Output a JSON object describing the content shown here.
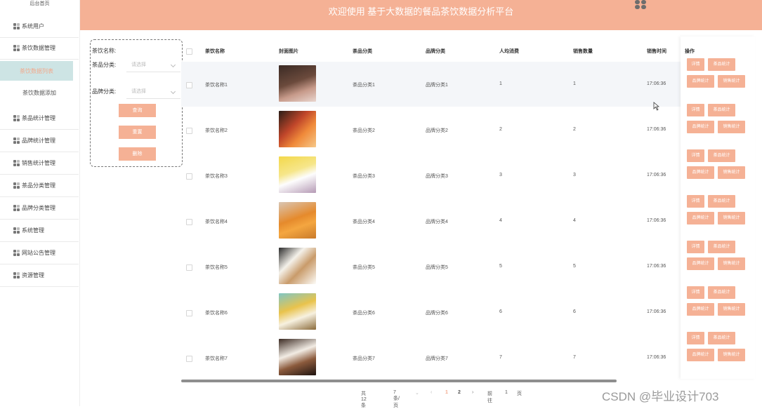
{
  "sidebar": {
    "home": "后台首页",
    "items": [
      {
        "label": "系统用户"
      },
      {
        "label": "茶饮数据管理"
      },
      {
        "label": "茶品统计管理"
      },
      {
        "label": "品牌统计管理"
      },
      {
        "label": "销售统计管理"
      },
      {
        "label": "茶品分类管理"
      },
      {
        "label": "品牌分类管理"
      },
      {
        "label": "系统管理"
      },
      {
        "label": "网站公告管理"
      },
      {
        "label": "资源管理"
      }
    ],
    "subitems": [
      {
        "label": "茶饮数据列表",
        "active": true
      },
      {
        "label": "茶饮数据添加",
        "active": false
      }
    ]
  },
  "header": {
    "title": "欢迎使用 基于大数据的餐品茶饮数据分析平台"
  },
  "search": {
    "name_label": "茶饮名称:",
    "category_label": "茶品分类:",
    "category_placeholder": "请选择",
    "brand_label": "品牌分类:",
    "brand_placeholder": "请选择",
    "query_button": "查询",
    "reset_button": "重置",
    "delete_button": "删除"
  },
  "table": {
    "columns": [
      "茶饮名称",
      "封面图片",
      "茶品分类",
      "品牌分类",
      "人均消费",
      "销售数量",
      "销售时间",
      "操作"
    ],
    "rows": [
      {
        "name": "茶饮名称1",
        "category": "茶品分类1",
        "brand": "品牌分类1",
        "avg": "1",
        "qty": "1",
        "time": "17:06:36"
      },
      {
        "name": "茶饮名称2",
        "category": "茶品分类2",
        "brand": "品牌分类2",
        "avg": "2",
        "qty": "2",
        "time": "17:06:36"
      },
      {
        "name": "茶饮名称3",
        "category": "茶品分类3",
        "brand": "品牌分类3",
        "avg": "3",
        "qty": "3",
        "time": "17:06:36"
      },
      {
        "name": "茶饮名称4",
        "category": "茶品分类4",
        "brand": "品牌分类4",
        "avg": "4",
        "qty": "4",
        "time": "17:06:36"
      },
      {
        "name": "茶饮名称5",
        "category": "茶品分类5",
        "brand": "品牌分类5",
        "avg": "5",
        "qty": "5",
        "time": "17:06:36"
      },
      {
        "name": "茶饮名称6",
        "category": "茶品分类6",
        "brand": "品牌分类6",
        "avg": "6",
        "qty": "6",
        "time": "17:06:36"
      },
      {
        "name": "茶饮名称7",
        "category": "茶品分类7",
        "brand": "品牌分类7",
        "avg": "7",
        "qty": "7",
        "time": "17:06:36"
      }
    ],
    "actions": {
      "detail": "详情",
      "tea_stats": "茶品统计",
      "brand_stats": "品牌统计",
      "sales_stats": "销售统计"
    }
  },
  "pagination": {
    "total": "共 12 条",
    "page_size": "7条/页",
    "pages": [
      "1",
      "2"
    ],
    "goto_label": "前往",
    "goto_value": "1",
    "page_unit": "页"
  },
  "watermark": "CSDN @毕业设计703",
  "colors": {
    "accent": "#f5b195",
    "active_bg": "#cde4e4"
  }
}
